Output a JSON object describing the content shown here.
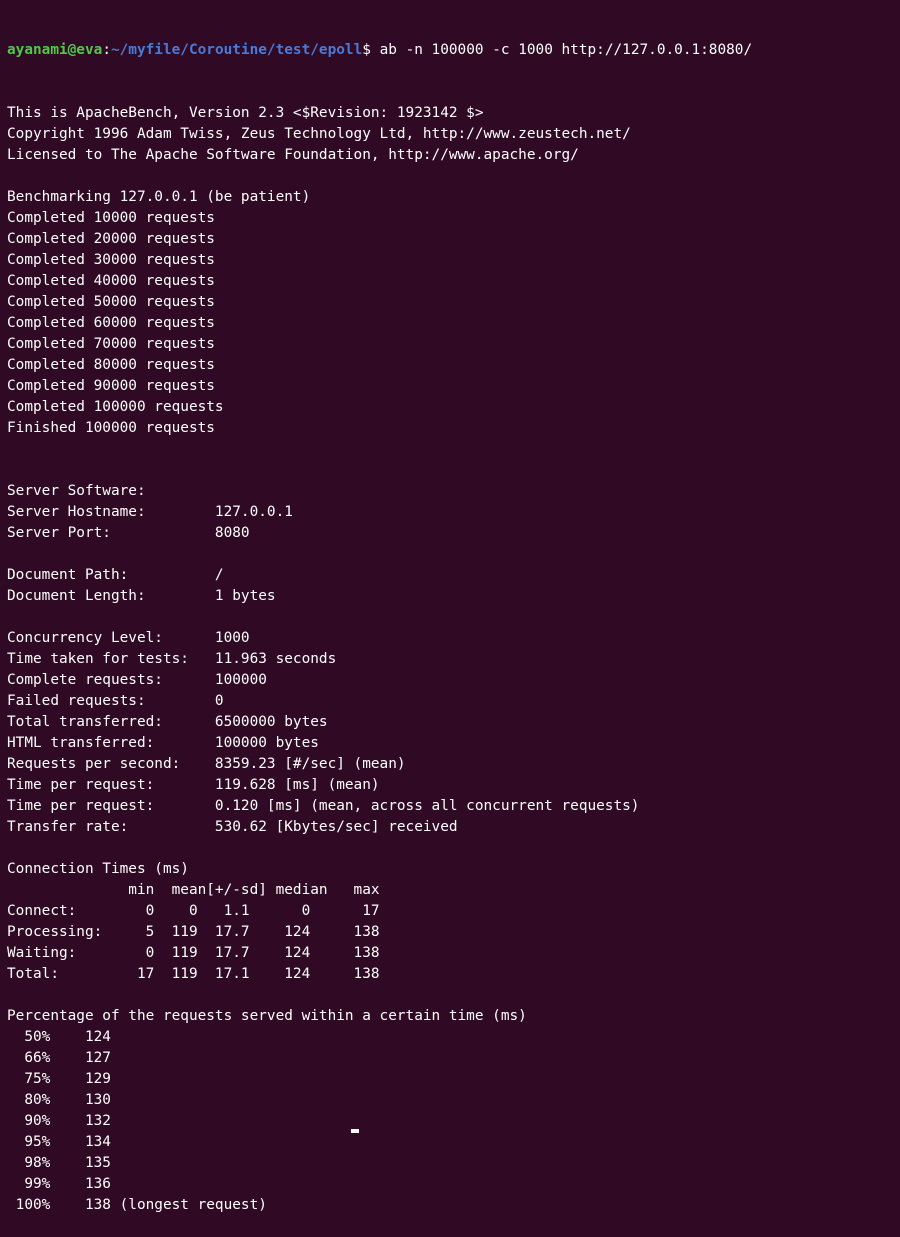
{
  "prompt": {
    "user_host": "ayanami@eva",
    "separator": ":",
    "path": "~/myfile/Coroutine/test/epoll",
    "symbol": "$ ",
    "command": "ab -n 100000 -c 1000 http://127.0.0.1:8080/"
  },
  "output_lines": [
    "This is ApacheBench, Version 2.3 <$Revision: 1923142 $>",
    "Copyright 1996 Adam Twiss, Zeus Technology Ltd, http://www.zeustech.net/",
    "Licensed to The Apache Software Foundation, http://www.apache.org/",
    "",
    "Benchmarking 127.0.0.1 (be patient)",
    "Completed 10000 requests",
    "Completed 20000 requests",
    "Completed 30000 requests",
    "Completed 40000 requests",
    "Completed 50000 requests",
    "Completed 60000 requests",
    "Completed 70000 requests",
    "Completed 80000 requests",
    "Completed 90000 requests",
    "Completed 100000 requests",
    "Finished 100000 requests",
    "",
    "",
    "Server Software:",
    "Server Hostname:        127.0.0.1",
    "Server Port:            8080",
    "",
    "Document Path:          /",
    "Document Length:        1 bytes",
    "",
    "Concurrency Level:      1000",
    "Time taken for tests:   11.963 seconds",
    "Complete requests:      100000",
    "Failed requests:        0",
    "Total transferred:      6500000 bytes",
    "HTML transferred:       100000 bytes",
    "Requests per second:    8359.23 [#/sec] (mean)",
    "Time per request:       119.628 [ms] (mean)",
    "Time per request:       0.120 [ms] (mean, across all concurrent requests)",
    "Transfer rate:          530.62 [Kbytes/sec] received",
    "",
    "Connection Times (ms)",
    "              min  mean[+/-sd] median   max",
    "Connect:        0    0   1.1      0      17",
    "Processing:     5  119  17.7    124     138",
    "Waiting:        0  119  17.7    124     138",
    "Total:         17  119  17.1    124     138",
    "",
    "Percentage of the requests served within a certain time (ms)",
    "  50%    124",
    "  66%    127",
    "  75%    129",
    "  80%    130",
    "  90%    132",
    "  95%    134",
    "  98%    135",
    "  99%    136",
    " 100%    138 (longest request)"
  ],
  "colors": {
    "background": "#300a24",
    "text": "#ffffff",
    "prompt_user": "#4ec94b",
    "prompt_path": "#4a7ad6"
  }
}
